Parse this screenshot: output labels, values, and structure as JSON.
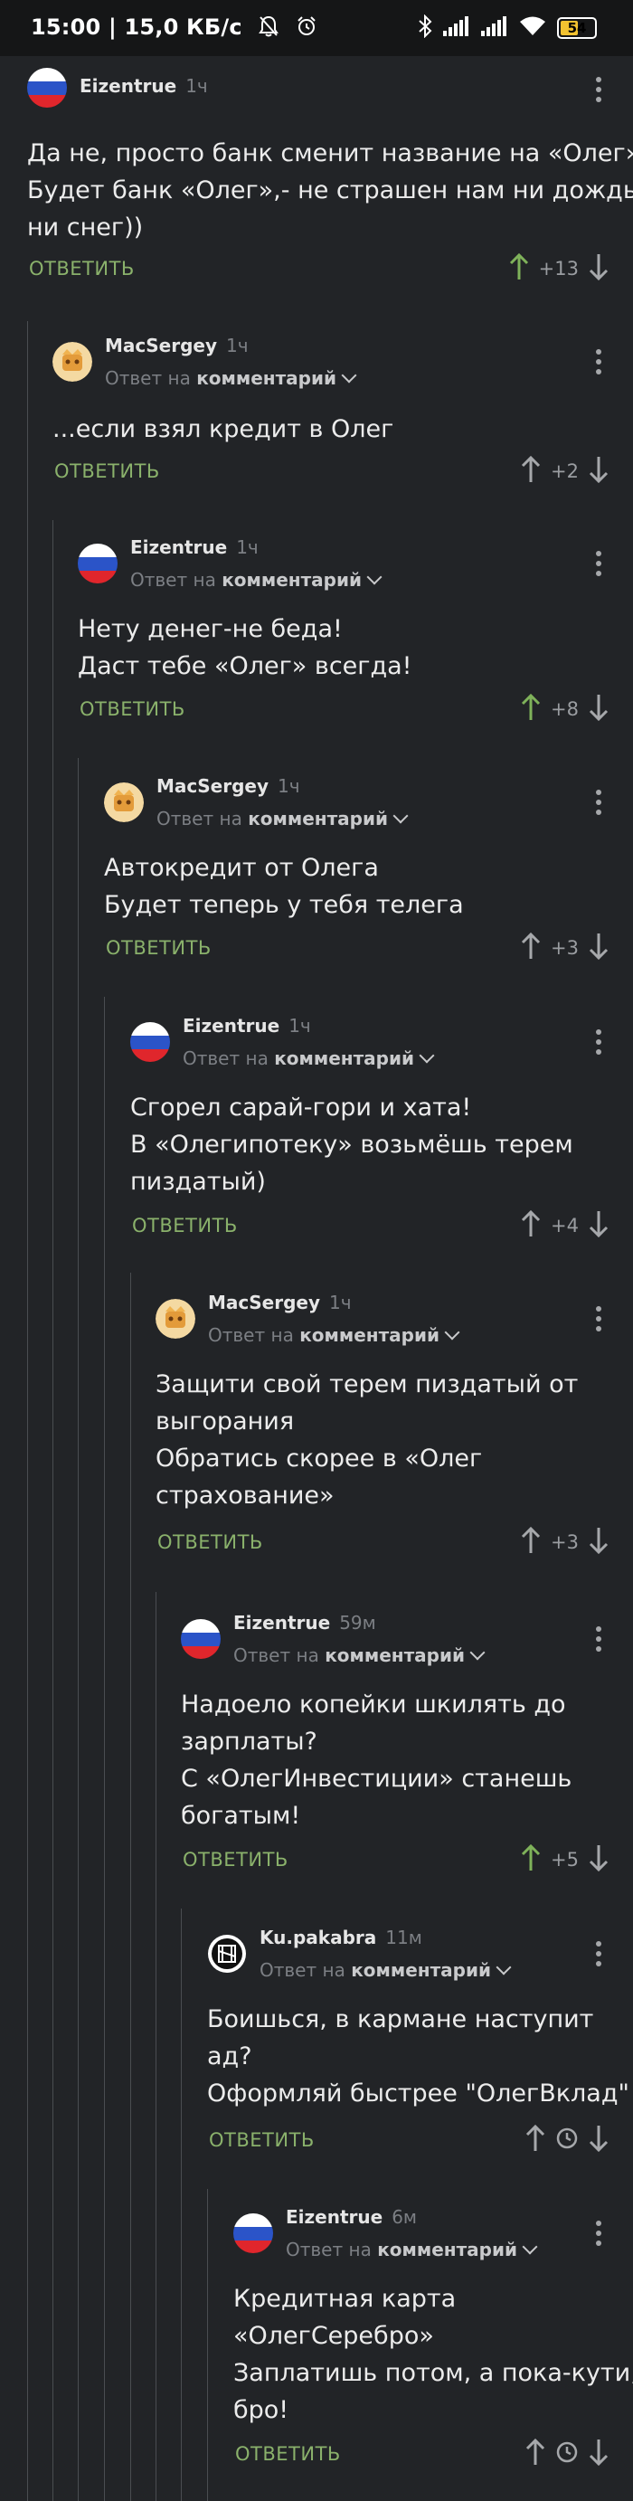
{
  "status_bar": {
    "time_speed": "15:00 | 15,0 КБ/с",
    "battery": "54",
    "icons": [
      "bell-off-icon",
      "alarm-icon",
      "bluetooth-icon",
      "signal-icon",
      "signal-icon",
      "wifi-icon",
      "battery-icon"
    ]
  },
  "colors": {
    "background": "#222427",
    "reply_green": "#8ab16b",
    "upvote_active": "#7fb25a",
    "text_muted": "#7c7f84"
  },
  "labels": {
    "reply": "ОТВЕТИТЬ",
    "reply_to_prefix": "Ответ на",
    "reply_to_target": "комментарий"
  },
  "comments": [
    {
      "author": "Eizentrue",
      "time": "1ч",
      "avatar": "russian-flag",
      "lines": [
        "Да не, просто банк сменит название на «Олег».",
        "Будет банк «Олег»,- не страшен нам ни дождь",
        "ни снег))"
      ],
      "rating": "+13",
      "upvoted": true
    },
    {
      "author": "MacSergey",
      "time": "1ч",
      "avatar": "macsergey-avatar",
      "lines": [
        "...если взял кредит в Олег"
      ],
      "rating": "+2",
      "upvoted": false
    },
    {
      "author": "Eizentrue",
      "time": "1ч",
      "avatar": "russian-flag",
      "lines": [
        "Нету денег-не беда!",
        "Даст тебе «Олег» всегда!"
      ],
      "rating": "+8",
      "upvoted": true
    },
    {
      "author": "MacSergey",
      "time": "1ч",
      "avatar": "macsergey-avatar",
      "lines": [
        "Автокредит от Олега",
        "Будет теперь у тебя телега"
      ],
      "rating": "+3",
      "upvoted": false
    },
    {
      "author": "Eizentrue",
      "time": "1ч",
      "avatar": "russian-flag",
      "lines": [
        "Сгорел сарай-гори и хата!",
        "В «Олегипотеку» возьмёшь терем",
        "пиздатый)"
      ],
      "rating": "+4",
      "upvoted": false
    },
    {
      "author": "MacSergey",
      "time": "1ч",
      "avatar": "macsergey-avatar",
      "lines": [
        "Защити свой терем пиздатый от",
        "выгорания",
        "Обратись скорее в «Олег",
        "страхование»"
      ],
      "rating": "+3",
      "upvoted": false
    },
    {
      "author": "Eizentrue",
      "time": "59м",
      "avatar": "russian-flag",
      "lines": [
        "Надоело копейки шкилять до",
        "зарплаты?",
        "С «ОлегИнвестиции» станешь",
        "богатым!"
      ],
      "rating": "+5",
      "upvoted": true
    },
    {
      "author": "Ku.pakabra",
      "time": "11м",
      "avatar": "rammstein-logo",
      "lines": [
        "Боишься, в кармане наступит",
        "ад?",
        "Оформляй быстрее \"ОлегВклад\""
      ],
      "rating": "",
      "pending": true,
      "upvoted": false
    },
    {
      "author": "Eizentrue",
      "time": "6м",
      "avatar": "russian-flag",
      "lines": [
        "Кредитная карта",
        "«ОлегСеребро»",
        "Заплатишь потом, а пока-кути,",
        "бро!"
      ],
      "rating": "",
      "pending": true,
      "upvoted": false
    }
  ]
}
